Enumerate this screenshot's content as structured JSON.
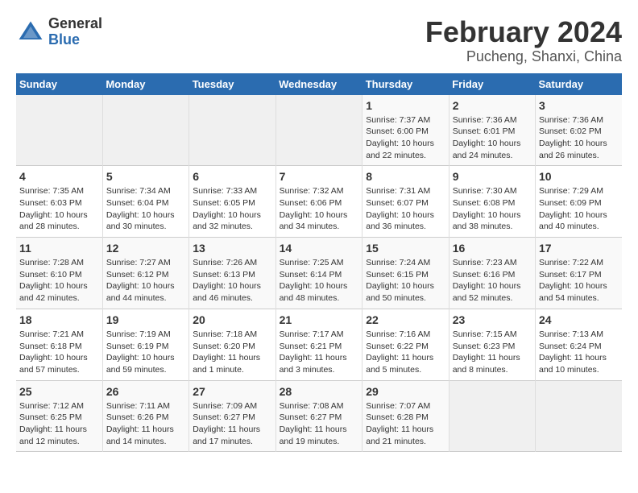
{
  "logo": {
    "general": "General",
    "blue": "Blue"
  },
  "header": {
    "title": "February 2024",
    "subtitle": "Pucheng, Shanxi, China"
  },
  "weekdays": [
    "Sunday",
    "Monday",
    "Tuesday",
    "Wednesday",
    "Thursday",
    "Friday",
    "Saturday"
  ],
  "weeks": [
    [
      {
        "day": "",
        "info": ""
      },
      {
        "day": "",
        "info": ""
      },
      {
        "day": "",
        "info": ""
      },
      {
        "day": "",
        "info": ""
      },
      {
        "day": "1",
        "info": "Sunrise: 7:37 AM\nSunset: 6:00 PM\nDaylight: 10 hours\nand 22 minutes."
      },
      {
        "day": "2",
        "info": "Sunrise: 7:36 AM\nSunset: 6:01 PM\nDaylight: 10 hours\nand 24 minutes."
      },
      {
        "day": "3",
        "info": "Sunrise: 7:36 AM\nSunset: 6:02 PM\nDaylight: 10 hours\nand 26 minutes."
      }
    ],
    [
      {
        "day": "4",
        "info": "Sunrise: 7:35 AM\nSunset: 6:03 PM\nDaylight: 10 hours\nand 28 minutes."
      },
      {
        "day": "5",
        "info": "Sunrise: 7:34 AM\nSunset: 6:04 PM\nDaylight: 10 hours\nand 30 minutes."
      },
      {
        "day": "6",
        "info": "Sunrise: 7:33 AM\nSunset: 6:05 PM\nDaylight: 10 hours\nand 32 minutes."
      },
      {
        "day": "7",
        "info": "Sunrise: 7:32 AM\nSunset: 6:06 PM\nDaylight: 10 hours\nand 34 minutes."
      },
      {
        "day": "8",
        "info": "Sunrise: 7:31 AM\nSunset: 6:07 PM\nDaylight: 10 hours\nand 36 minutes."
      },
      {
        "day": "9",
        "info": "Sunrise: 7:30 AM\nSunset: 6:08 PM\nDaylight: 10 hours\nand 38 minutes."
      },
      {
        "day": "10",
        "info": "Sunrise: 7:29 AM\nSunset: 6:09 PM\nDaylight: 10 hours\nand 40 minutes."
      }
    ],
    [
      {
        "day": "11",
        "info": "Sunrise: 7:28 AM\nSunset: 6:10 PM\nDaylight: 10 hours\nand 42 minutes."
      },
      {
        "day": "12",
        "info": "Sunrise: 7:27 AM\nSunset: 6:12 PM\nDaylight: 10 hours\nand 44 minutes."
      },
      {
        "day": "13",
        "info": "Sunrise: 7:26 AM\nSunset: 6:13 PM\nDaylight: 10 hours\nand 46 minutes."
      },
      {
        "day": "14",
        "info": "Sunrise: 7:25 AM\nSunset: 6:14 PM\nDaylight: 10 hours\nand 48 minutes."
      },
      {
        "day": "15",
        "info": "Sunrise: 7:24 AM\nSunset: 6:15 PM\nDaylight: 10 hours\nand 50 minutes."
      },
      {
        "day": "16",
        "info": "Sunrise: 7:23 AM\nSunset: 6:16 PM\nDaylight: 10 hours\nand 52 minutes."
      },
      {
        "day": "17",
        "info": "Sunrise: 7:22 AM\nSunset: 6:17 PM\nDaylight: 10 hours\nand 54 minutes."
      }
    ],
    [
      {
        "day": "18",
        "info": "Sunrise: 7:21 AM\nSunset: 6:18 PM\nDaylight: 10 hours\nand 57 minutes."
      },
      {
        "day": "19",
        "info": "Sunrise: 7:19 AM\nSunset: 6:19 PM\nDaylight: 10 hours\nand 59 minutes."
      },
      {
        "day": "20",
        "info": "Sunrise: 7:18 AM\nSunset: 6:20 PM\nDaylight: 11 hours\nand 1 minute."
      },
      {
        "day": "21",
        "info": "Sunrise: 7:17 AM\nSunset: 6:21 PM\nDaylight: 11 hours\nand 3 minutes."
      },
      {
        "day": "22",
        "info": "Sunrise: 7:16 AM\nSunset: 6:22 PM\nDaylight: 11 hours\nand 5 minutes."
      },
      {
        "day": "23",
        "info": "Sunrise: 7:15 AM\nSunset: 6:23 PM\nDaylight: 11 hours\nand 8 minutes."
      },
      {
        "day": "24",
        "info": "Sunrise: 7:13 AM\nSunset: 6:24 PM\nDaylight: 11 hours\nand 10 minutes."
      }
    ],
    [
      {
        "day": "25",
        "info": "Sunrise: 7:12 AM\nSunset: 6:25 PM\nDaylight: 11 hours\nand 12 minutes."
      },
      {
        "day": "26",
        "info": "Sunrise: 7:11 AM\nSunset: 6:26 PM\nDaylight: 11 hours\nand 14 minutes."
      },
      {
        "day": "27",
        "info": "Sunrise: 7:09 AM\nSunset: 6:27 PM\nDaylight: 11 hours\nand 17 minutes."
      },
      {
        "day": "28",
        "info": "Sunrise: 7:08 AM\nSunset: 6:27 PM\nDaylight: 11 hours\nand 19 minutes."
      },
      {
        "day": "29",
        "info": "Sunrise: 7:07 AM\nSunset: 6:28 PM\nDaylight: 11 hours\nand 21 minutes."
      },
      {
        "day": "",
        "info": ""
      },
      {
        "day": "",
        "info": ""
      }
    ]
  ]
}
